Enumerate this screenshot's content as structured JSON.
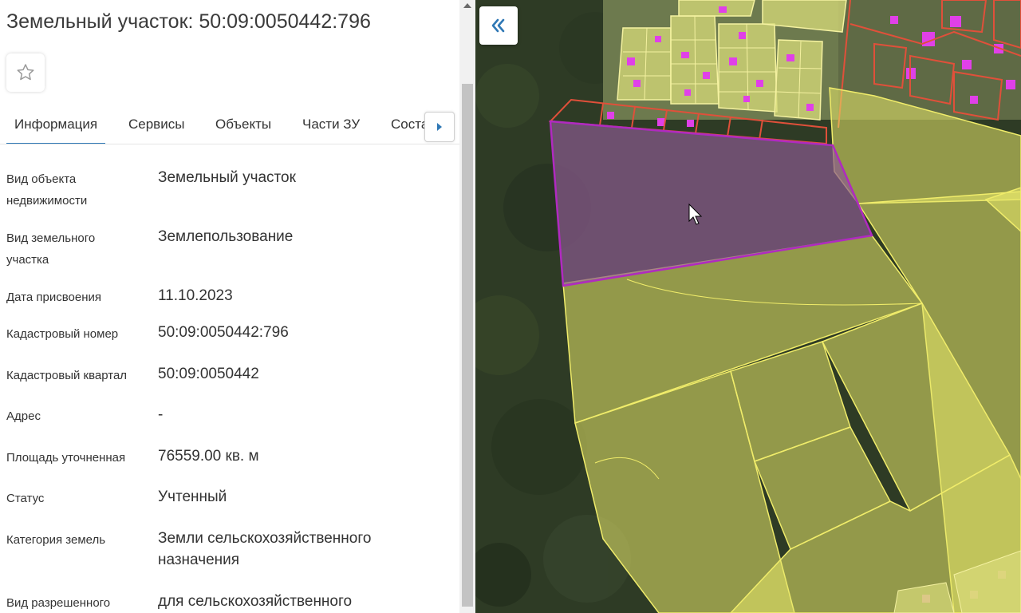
{
  "panel": {
    "title": "Земельный участок: 50:09:0050442:796",
    "tabs": [
      {
        "label": "Информация"
      },
      {
        "label": "Сервисы"
      },
      {
        "label": "Объекты"
      },
      {
        "label": "Части ЗУ"
      },
      {
        "label": "Соста"
      }
    ],
    "rows": [
      {
        "label": "Вид объекта недвижимости",
        "value": "Земельный участок"
      },
      {
        "label": "Вид земельного участка",
        "value": "Землепользование"
      },
      {
        "label": "Дата присвоения",
        "value": "11.10.2023"
      },
      {
        "label": "Кадастровый номер",
        "value": "50:09:0050442:796"
      },
      {
        "label": "Кадастровый квартал",
        "value": "50:09:0050442"
      },
      {
        "label": "Адрес",
        "value": "-"
      },
      {
        "label": "Площадь уточненная",
        "value": "76559.00 кв. м"
      },
      {
        "label": "Статус",
        "value": "Учтенный"
      },
      {
        "label": "Категория земель",
        "value": "Земли сельскохозяйственного назначения"
      },
      {
        "label": "Вид разрешенного",
        "value": "для сельскохозяйственного"
      }
    ]
  },
  "icons": {
    "favorite": "star-outline-icon",
    "tabs_next": "chevron-right-icon",
    "collapse": "double-chevron-left-icon"
  },
  "colors": {
    "accent": "#2f78b5",
    "selected_parcel_outline": "#b02ac0",
    "parcel_fill": "#e7e76a",
    "parcel_outline": "#f0ec6a",
    "building_fill": "#e040e8",
    "boundary_red": "#e0503a"
  }
}
